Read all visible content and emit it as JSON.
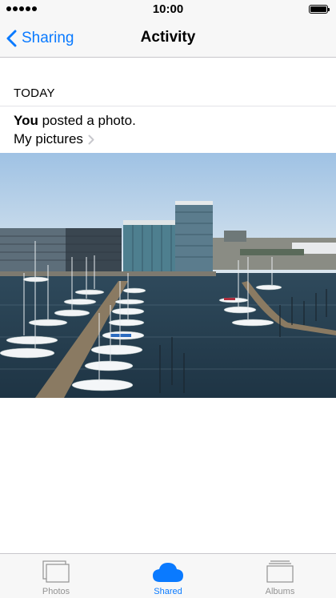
{
  "status_bar": {
    "time": "10:00",
    "battery_level": 1.0
  },
  "nav": {
    "back_label": "Sharing",
    "title": "Activity"
  },
  "feed": {
    "section_header": "TODAY",
    "activity": {
      "actor": "You",
      "action": " posted a photo.",
      "album": "My pictures"
    }
  },
  "photo": {
    "subject": "harbor marina with sailboats and office buildings"
  },
  "tabs": [
    {
      "label": "Photos",
      "icon": "photos-icon",
      "active": false
    },
    {
      "label": "Shared",
      "icon": "cloud-icon",
      "active": true
    },
    {
      "label": "Albums",
      "icon": "albums-icon",
      "active": false
    }
  ],
  "colors": {
    "accent": "#0a7aff",
    "inactive": "#929292",
    "bar_bg": "#f7f7f7"
  }
}
